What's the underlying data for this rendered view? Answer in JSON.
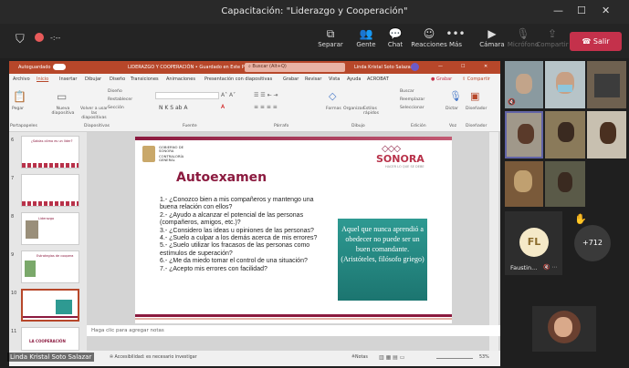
{
  "window": {
    "title": "Capacitación: \"Liderazgo y Cooperación\"",
    "min": "—",
    "max": "☐",
    "close": "✕"
  },
  "meeting": {
    "timer": "-:--"
  },
  "toolbar": [
    {
      "label": "Separar",
      "icon": "⧉"
    },
    {
      "label": "Gente",
      "icon": "👥"
    },
    {
      "label": "Chat",
      "icon": "💬"
    },
    {
      "label": "Reacciones",
      "icon": "☺"
    },
    {
      "label": "Más",
      "icon": "•••"
    },
    {
      "label": "Cámara",
      "icon": "▶"
    },
    {
      "label": "Micrófono",
      "icon": "🎙"
    },
    {
      "label": "Compartir",
      "icon": "⇪"
    }
  ],
  "leave_label": "Salir",
  "ppt": {
    "autosave": "Autoguardado",
    "title_file": "LIDERAZGO Y COOPERACIÓN • Guardado en Este PC",
    "search": "Buscar (Alt+Q)",
    "user": "Linda Kristal Soto Salazar",
    "menu": [
      "Archivo",
      "Inicio",
      "Insertar",
      "Dibujar",
      "Diseño",
      "Transiciones",
      "Animaciones",
      "Presentación con diapositivas",
      "Grabar",
      "Revisar",
      "Vista",
      "Ayuda",
      "ACROBAT"
    ],
    "grabar": "Grabar",
    "compartir": "Compartir",
    "ribbon_groups": [
      "Portapapeles",
      "Diapositivas",
      "Fuente",
      "Párrafo",
      "Dibujo",
      "Edición",
      "Voz",
      "Diseñador"
    ],
    "ribbon_btns": [
      "Pegar",
      "Nueva diapositiva",
      "Volver a usar las diapositivas",
      "Diseño",
      "Restablecer",
      "Sección",
      "Formas",
      "Organizar",
      "Estilos rápidos",
      "Buscar",
      "Reemplazar",
      "Seleccionar",
      "Dictar",
      "Diseñador"
    ],
    "thumb_nums": [
      "6",
      "7",
      "8",
      "9",
      "10",
      "11"
    ],
    "thumb6_title": "¿Sabías cómo es un líder?",
    "thumb8_title": "Liderazgo",
    "thumb9_title": "Estrategias de coopera",
    "thumb11_title": "LA COOPERACIÓN",
    "notes": "Haga clic para agregar notas",
    "status_access": "Accesibilidad: es necesario investigar",
    "status_notes": "Notas",
    "zoom": "53%"
  },
  "slide": {
    "gov_logo": "GOBIERNO DE SONORA",
    "gov_logo2": "CONTRALORÍA GENERAL",
    "brand": "SONORA",
    "brand_tag": "HACER LO QUE SE DEBE",
    "heading": "Autoexamen",
    "questions": [
      "1.- ¿Conozco bien a mis compañeros y mantengo una buena relación con ellos?",
      "2.- ¿Ayudo a alcanzar el potencial de las personas (compañeros, amigos, etc.)?",
      "3.- ¿Considero las ideas u opiniones de las personas?",
      "4.- ¿Suelo a culpar a los demás acerca de mis errores?",
      "5.- ¿Suelo utilizar los fracasos de las personas como estímulos de superación?",
      "6.- ¿Me da miedo tomar el control de una situación?",
      "7.- ¿Acepto mis errores con facilidad?"
    ],
    "quote": "Aquel que nunca aprendió a obedecer no puede ser un buen comandante. (Aristóteles, filósofo griego)"
  },
  "presenter_name": "Linda Kristal Soto Salazar",
  "participants": {
    "fl_initials": "FL",
    "fl_name": "Faustin...",
    "more_count": "+712",
    "hand_icon": "✋"
  },
  "colors": {
    "brand_maroon": "#8b1a3f",
    "ppt_red": "#b7472a",
    "leave_red": "#c4314b",
    "slide_teal": "#2e9a92"
  }
}
